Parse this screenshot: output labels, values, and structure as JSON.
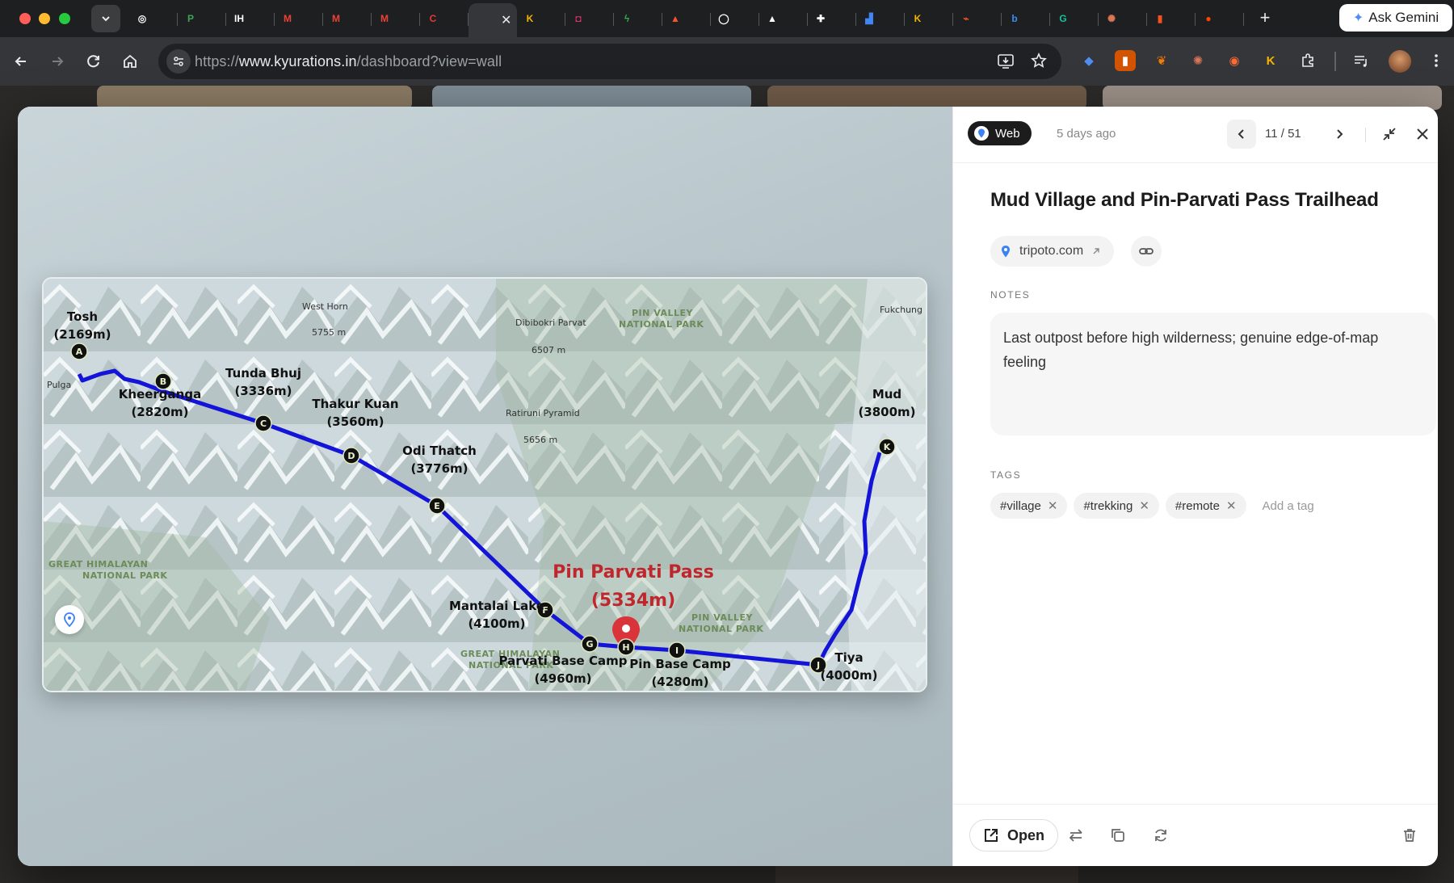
{
  "browser": {
    "tabs": [
      {
        "icon": "openai-icon",
        "color": "#ffffff"
      },
      {
        "icon": "p-app-icon",
        "color": "#3da35d"
      },
      {
        "icon": "ih-icon",
        "color": "#ffffff"
      },
      {
        "icon": "gmail-icon",
        "color": "#ea4335"
      },
      {
        "icon": "gmail-icon",
        "color": "#ea4335"
      },
      {
        "icon": "gmail-icon",
        "color": "#ea4335"
      },
      {
        "icon": "red-c-icon",
        "color": "#e53935"
      },
      {
        "icon": "active-tab-icon",
        "color": "#ffffff",
        "active": true
      },
      {
        "icon": "kyurations-icon",
        "color": "#f4b400"
      },
      {
        "icon": "instagram-icon",
        "color": "#e1306c"
      },
      {
        "icon": "bolt-icon",
        "color": "#34a853"
      },
      {
        "icon": "brave-icon",
        "color": "#fb542b"
      },
      {
        "icon": "github-icon",
        "color": "#ffffff"
      },
      {
        "icon": "triangle-icon",
        "color": "#ffffff"
      },
      {
        "icon": "puzzle-icon",
        "color": "#ffffff"
      },
      {
        "icon": "chart-icon",
        "color": "#4285f4"
      },
      {
        "icon": "kyurations-icon",
        "color": "#f4b400"
      },
      {
        "icon": "trend-icon",
        "color": "#f4511e"
      },
      {
        "icon": "bing-icon",
        "color": "#3c8cf5"
      },
      {
        "icon": "grammarly-icon",
        "color": "#15c39a"
      },
      {
        "icon": "claude-icon",
        "color": "#d97757"
      },
      {
        "icon": "bookmark-icon",
        "color": "#f4511e"
      },
      {
        "icon": "reddit-icon",
        "color": "#ff4500"
      }
    ],
    "ask_gemini": "Ask Gemini",
    "url_scheme": "https://",
    "url_host": "www.kyurations.in",
    "url_path": "/dashboard?view=wall"
  },
  "modal": {
    "source_label": "Web",
    "time_ago": "5 days ago",
    "counter": "11 / 51",
    "title": "Mud Village and Pin-Parvati Pass Trailhead",
    "domain": "tripoto.com",
    "notes_label": "NOTES",
    "notes": "Last outpost before high wilderness; genuine edge-of-map feeling",
    "tags_label": "TAGS",
    "tags": [
      "#village",
      "#trekking",
      "#remote"
    ],
    "add_tag_placeholder": "Add a tag",
    "open_label": "Open"
  },
  "map": {
    "route_color": "#1414d8",
    "pass_color": "#c0272d",
    "stops": [
      {
        "letter": "A",
        "name": "Tosh",
        "elev": "(2169m)"
      },
      {
        "letter": "B",
        "name": "Kheerganga",
        "elev": "(2820m)"
      },
      {
        "letter": "C",
        "name": "Tunda Bhuj",
        "elev": "(3336m)"
      },
      {
        "letter": "D",
        "name": "Thakur Kuan",
        "elev": "(3560m)"
      },
      {
        "letter": "E",
        "name": "Odi Thatch",
        "elev": "(3776m)"
      },
      {
        "letter": "F",
        "name": "Mantalai Lake",
        "elev": "(4100m)"
      },
      {
        "letter": "G",
        "name": "Parvati Base Camp",
        "elev": "(4960m)"
      },
      {
        "letter": "H",
        "name": "",
        "elev": ""
      },
      {
        "letter": "I",
        "name": "Pin Base Camp",
        "elev": "(4280m)"
      },
      {
        "letter": "J",
        "name": "Tiya",
        "elev": "(4000m)"
      },
      {
        "letter": "K",
        "name": "Mud",
        "elev": "(3800m)"
      }
    ],
    "pass_name": "Pin Parvati Pass",
    "pass_elev": "(5334m)",
    "place_labels": {
      "pulga": "Pulga",
      "fukchung": "Fukchung",
      "west_horn": "West Horn",
      "west_horn_elev": "5755 m",
      "dibibokri": "Dibibokri Parvat",
      "dibibokri_elev": "6507 m",
      "ratiruni": "Ratiruni Pyramid",
      "ratiruni_elev": "5656 m",
      "pin_valley_np_1": "PIN VALLEY",
      "pin_valley_np_2": "NATIONAL PARK",
      "ghnp_1": "GREAT HIMALAYAN",
      "ghnp_2": "NATIONAL PARK",
      "ghnp_small_1": "GREAT HIMALAYAN",
      "ghnp_small_2": "NATIONAL PARK"
    }
  }
}
